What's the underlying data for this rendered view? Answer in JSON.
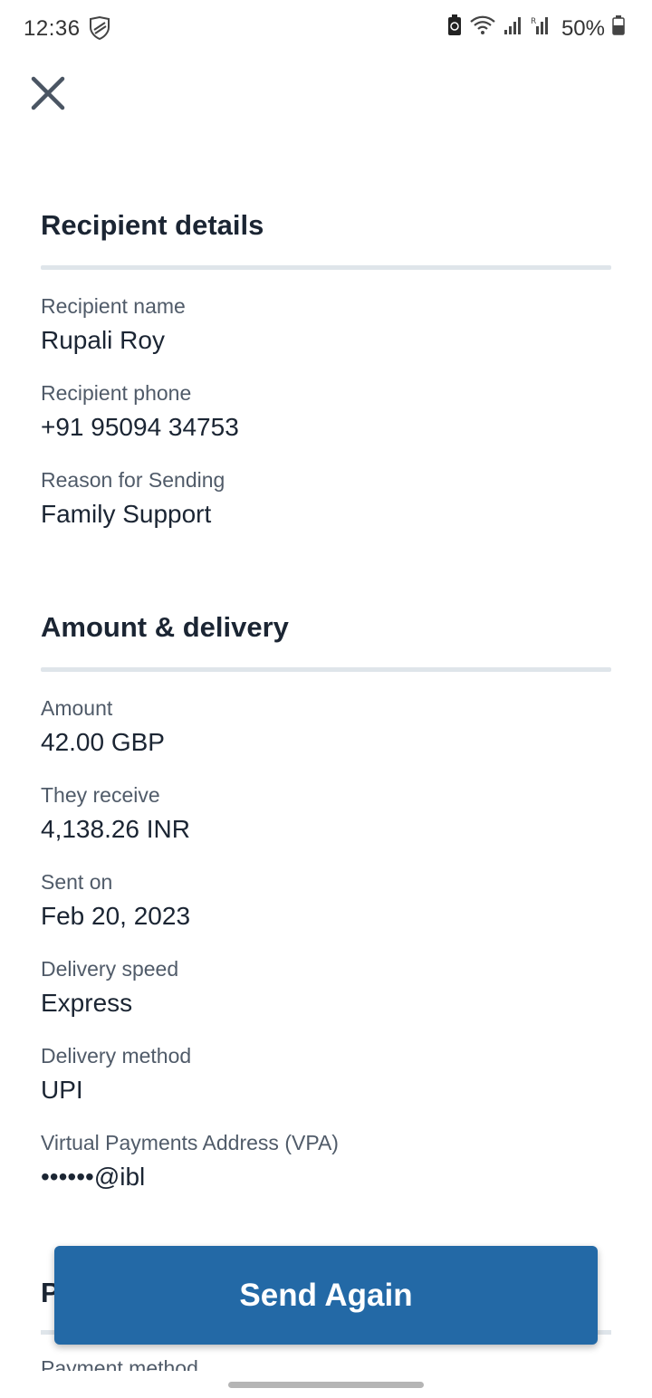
{
  "status_bar": {
    "time": "12:36",
    "battery_percent": "50%"
  },
  "recipient_section": {
    "title": "Recipient details",
    "fields": [
      {
        "label": "Recipient name",
        "value": "Rupali Roy"
      },
      {
        "label": "Recipient phone",
        "value": "+91 95094 34753"
      },
      {
        "label": "Reason for Sending",
        "value": "Family Support"
      }
    ]
  },
  "amount_section": {
    "title": "Amount & delivery",
    "fields": [
      {
        "label": "Amount",
        "value": "42.00 GBP"
      },
      {
        "label": "They receive",
        "value": "4,138.26 INR"
      },
      {
        "label": "Sent on",
        "value": "Feb 20, 2023"
      },
      {
        "label": "Delivery speed",
        "value": "Express"
      },
      {
        "label": "Delivery method",
        "value": "UPI"
      },
      {
        "label": "Virtual Payments Address (VPA)",
        "value": "••••••@ibl"
      }
    ]
  },
  "payment_section": {
    "title_visible": "P",
    "first_label": "Payment method"
  },
  "actions": {
    "send_again_label": "Send Again"
  },
  "colors": {
    "primary": "#2369a6",
    "text": "#1b2533",
    "label": "#505b69",
    "divider": "#dfe5ea"
  },
  "icons": [
    "close-icon",
    "shield-icon",
    "battery-saver-icon",
    "wifi-icon",
    "signal-icon",
    "battery-icon"
  ]
}
